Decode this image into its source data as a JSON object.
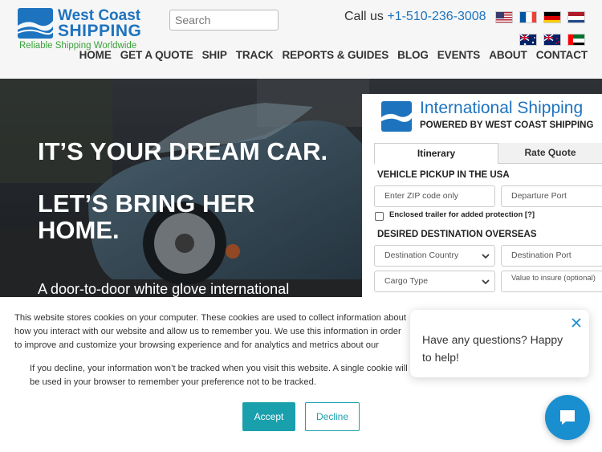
{
  "header": {
    "logo": {
      "line1": "West Coast",
      "line2": "SHIPPING",
      "tagline": "Reliable Shipping Worldwide",
      "mark_color": "#1e73be"
    },
    "search": {
      "placeholder": "Search",
      "value": ""
    },
    "call": {
      "prefix": "Call us",
      "phone": "+1-510-236-3008"
    },
    "flags": [
      "us-flag-icon",
      "france-flag-icon",
      "germany-flag-icon",
      "netherlands-flag-icon",
      "australia-flag-icon",
      "new-zealand-flag-icon",
      "uae-flag-icon"
    ],
    "nav": [
      "HOME",
      "GET A QUOTE",
      "SHIP",
      "TRACK",
      "REPORTS & GUIDES",
      "BLOG",
      "EVENTS",
      "ABOUT",
      "CONTACT"
    ]
  },
  "hero": {
    "line1": "IT’S YOUR DREAM CAR.",
    "line2": "LET’S BRING HER HOME.",
    "subtitle": "A door-to-door white glove international"
  },
  "widget": {
    "title": "International Shipping",
    "powered": "POWERED BY WEST COAST SHIPPING",
    "logo_text": "West Coast SHIPPING",
    "tabs": {
      "active": "Itinerary",
      "other": "Rate Quote"
    },
    "pickup_heading": "VEHICLE PICKUP IN THE USA",
    "zip_placeholder": "Enter ZIP code only",
    "departure_port": "Departure Port",
    "enclosed_label": "Enclosed trailer for added protection",
    "enclosed_help": "[?]",
    "destination_heading": "DESIRED DESTINATION OVERSEAS",
    "destination_country": "Destination Country",
    "destination_port": "Destination Port",
    "cargo_type": "Cargo Type",
    "insure_placeholder": "Value to insure (optional)"
  },
  "cookie": {
    "text1": "This website stores cookies on your computer. These cookies are used to collect information about how you interact with our website and allow us to remember you. We use this information in order to improve and customize your browsing experience and for analytics and metrics about our visitors both on this website and other media. To find out more about the cookies we use, see our Privacy Policy.",
    "text2": "If you decline, your information won’t be tracked when you visit this website. A single cookie will be used in your browser to remember your preference not to be tracked.",
    "accept": "Accept",
    "decline": "Decline",
    "accent": "#1aa0ad"
  },
  "chat": {
    "message": "Have any questions? Happy to help!",
    "launcher_color": "#1a8fcf"
  }
}
